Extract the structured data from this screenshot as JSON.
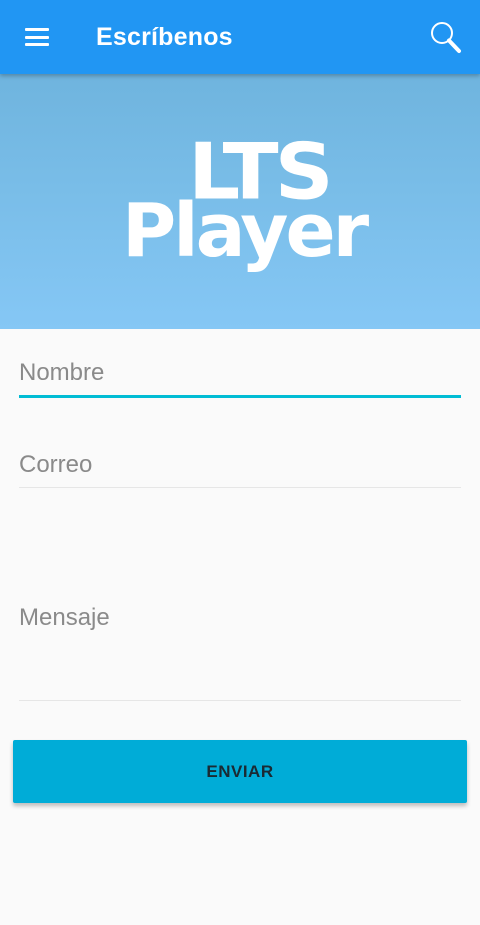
{
  "appbar": {
    "title": "Escríbenos",
    "menu_icon": "hamburger-menu-icon",
    "search_icon": "search-icon",
    "background": "#2196f3"
  },
  "banner": {
    "logo_line1": "LTS",
    "logo_line2": "Player"
  },
  "form": {
    "fields": [
      {
        "label": "Nombre",
        "active": true
      },
      {
        "label": "Correo",
        "active": false
      },
      {
        "label": "Mensaje",
        "active": false
      }
    ],
    "submit_label": "ENVIAR",
    "accent": "#00bcd4",
    "button_color": "#00acd7"
  }
}
